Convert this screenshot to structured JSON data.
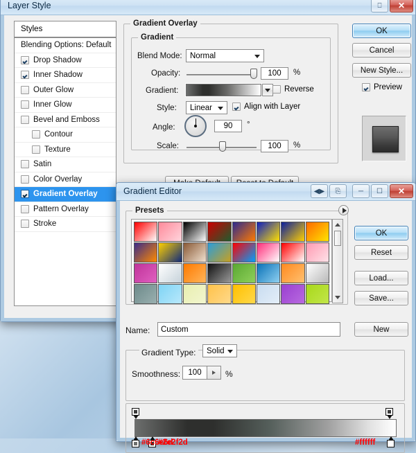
{
  "layer_style": {
    "title": "Layer Style",
    "titlebar_buttons": [
      "restore-icon",
      "close-icon"
    ],
    "styles_panel": {
      "header": "Styles",
      "items": [
        {
          "label": "Blending Options: Default",
          "checkbox": false,
          "has_checkbox": false,
          "indent": false,
          "selected": false
        },
        {
          "label": "Drop Shadow",
          "checkbox": true,
          "has_checkbox": true,
          "indent": false,
          "selected": false
        },
        {
          "label": "Inner Shadow",
          "checkbox": true,
          "has_checkbox": true,
          "indent": false,
          "selected": false
        },
        {
          "label": "Outer Glow",
          "checkbox": false,
          "has_checkbox": true,
          "indent": false,
          "selected": false
        },
        {
          "label": "Inner Glow",
          "checkbox": false,
          "has_checkbox": true,
          "indent": false,
          "selected": false
        },
        {
          "label": "Bevel and Emboss",
          "checkbox": false,
          "has_checkbox": true,
          "indent": false,
          "selected": false
        },
        {
          "label": "Contour",
          "checkbox": false,
          "has_checkbox": true,
          "indent": true,
          "selected": false
        },
        {
          "label": "Texture",
          "checkbox": false,
          "has_checkbox": true,
          "indent": true,
          "selected": false
        },
        {
          "label": "Satin",
          "checkbox": false,
          "has_checkbox": true,
          "indent": false,
          "selected": false
        },
        {
          "label": "Color Overlay",
          "checkbox": false,
          "has_checkbox": true,
          "indent": false,
          "selected": false
        },
        {
          "label": "Gradient Overlay",
          "checkbox": true,
          "has_checkbox": true,
          "indent": false,
          "selected": true
        },
        {
          "label": "Pattern Overlay",
          "checkbox": false,
          "has_checkbox": true,
          "indent": false,
          "selected": false
        },
        {
          "label": "Stroke",
          "checkbox": false,
          "has_checkbox": true,
          "indent": false,
          "selected": false
        }
      ]
    },
    "panel": {
      "title": "Gradient Overlay",
      "group_title": "Gradient",
      "blend_mode_label": "Blend Mode:",
      "blend_mode_value": "Normal",
      "opacity_label": "Opacity:",
      "opacity_value": "100",
      "opacity_unit": "%",
      "gradient_label": "Gradient:",
      "reverse_label": "Reverse",
      "reverse_checked": false,
      "style_label": "Style:",
      "style_value": "Linear",
      "align_label": "Align with Layer",
      "align_checked": true,
      "angle_label": "Angle:",
      "angle_value": "90",
      "angle_unit": "°",
      "scale_label": "Scale:",
      "scale_value": "100",
      "scale_unit": "%",
      "make_default": "Make Default",
      "reset_to_default": "Reset to Default"
    },
    "buttons": {
      "ok": "OK",
      "cancel": "Cancel",
      "new_style": "New Style...",
      "preview_label": "Preview",
      "preview_checked": true
    }
  },
  "gradient_editor": {
    "title": "Gradient Editor",
    "titlebar_buttons": [
      "collapse-icon",
      "restore-icon",
      "minimize-icon",
      "maximize-icon",
      "close-icon"
    ],
    "presets_label": "Presets",
    "presets_menu_icon": "presets-menu-icon",
    "preset_swatches": [
      [
        "#ff0000",
        "#ffffff"
      ],
      [
        "#ff8a9a",
        "#ffd5dd"
      ],
      [
        "#000000",
        "#ffffff"
      ],
      [
        "#cc0000",
        "#1f5c2e"
      ],
      [
        "#2d2a8f",
        "#ff7a00"
      ],
      [
        "#1020c0",
        "#ffe000"
      ],
      [
        "#0b1f9e",
        "#ffd000"
      ],
      [
        "#ff6a00",
        "#ffe400"
      ],
      [
        "#3b2b8a",
        "#ff8a00"
      ],
      [
        "#ffd000",
        "#102a7a"
      ],
      [
        "#8a5a36",
        "#f0e0cf"
      ],
      [
        "#2a9ddb",
        "#c8a020"
      ],
      [
        "#ff0000",
        "#00a0ff"
      ],
      [
        "#ff2d7a",
        "#ffffff"
      ],
      [
        "#ff0000",
        "#ffffff"
      ],
      [
        "#ff9ab2",
        "#ffe2e8"
      ],
      [
        "#c0339a",
        "#e060c0"
      ],
      [
        "#ffffff",
        "#c6d2da"
      ],
      [
        "#ff7a00",
        "#ffb55a"
      ],
      [
        "#111111",
        "#9a9a9a"
      ],
      [
        "#5aa832",
        "#8fd05a"
      ],
      [
        "#0a72b8",
        "#8fd0f0"
      ],
      [
        "#ff8a20",
        "#ffc070"
      ],
      [
        "#ffffff",
        "#b8b8b8"
      ],
      [
        "#6d8a8a",
        "#9ab0b0"
      ],
      [
        "#7fd4f5",
        "#b8e8fb"
      ],
      [
        "#e8eeb0",
        "#f2f6cf"
      ],
      [
        "#ffc24a",
        "#ffd98a"
      ],
      [
        "#ffc000",
        "#ffd84a"
      ],
      [
        "#c8dcf0",
        "#e4eef8"
      ],
      [
        "#9a3fd0",
        "#b86ae0"
      ],
      [
        "#a8d81a",
        "#c2e64a"
      ]
    ],
    "name_label": "Name:",
    "name_value": "Custom",
    "new_button": "New",
    "gradient_type_label": "Gradient Type:",
    "gradient_type_value": "Solid",
    "smoothness_label": "Smoothness:",
    "smoothness_value": "100",
    "smoothness_unit": "%",
    "stops": [
      {
        "type": "opacity",
        "position": 0,
        "color": "#3a3a3a"
      },
      {
        "type": "opacity",
        "position": 100,
        "color": "#3a3a3a"
      },
      {
        "type": "color",
        "position": 0,
        "hex": "#6c6e6d",
        "swatch": "#6c6e6d"
      },
      {
        "type": "color",
        "position": 6,
        "hex": "#2e2f2d",
        "swatch": "#2e2f2d"
      },
      {
        "type": "color",
        "position": 100,
        "hex": "#ffffff",
        "swatch": "#ffffff"
      }
    ],
    "hex_labels": {
      "stop1": "#6c6e6d",
      "stop2": "#2e2f2d",
      "stop3": "#ffffff"
    },
    "buttons": {
      "ok": "OK",
      "reset": "Reset",
      "load": "Load...",
      "save": "Save..."
    }
  }
}
